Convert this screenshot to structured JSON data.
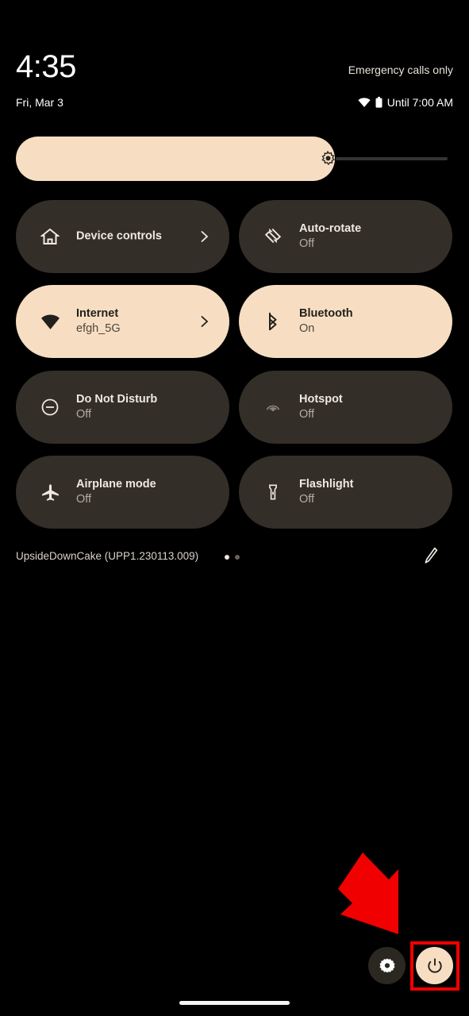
{
  "statusbar": {
    "time": "4:35",
    "date": "Fri, Mar 3",
    "carrier": "Emergency calls only",
    "alarm_text": "Until 7:00 AM",
    "wifi_icon": "wifi-icon",
    "battery_icon": "battery-icon"
  },
  "brightness": {
    "icon": "brightness-icon",
    "level_percent": 73,
    "fill_color": "#f7dec2",
    "track_color": "#343434"
  },
  "tiles": [
    {
      "label": "Device controls",
      "state": "",
      "icon": "home-icon",
      "active": false,
      "chevron": true,
      "dim_icon": false
    },
    {
      "label": "Auto-rotate",
      "state": "Off",
      "icon": "auto-rotate-icon",
      "active": false,
      "chevron": false,
      "dim_icon": false
    },
    {
      "label": "Internet",
      "state": "efgh_5G",
      "icon": "wifi-icon",
      "active": true,
      "chevron": true,
      "dim_icon": false
    },
    {
      "label": "Bluetooth",
      "state": "On",
      "icon": "bluetooth-icon",
      "active": true,
      "chevron": false,
      "dim_icon": false
    },
    {
      "label": "Do Not Disturb",
      "state": "Off",
      "icon": "do-not-disturb-icon",
      "active": false,
      "chevron": false,
      "dim_icon": false
    },
    {
      "label": "Hotspot",
      "state": "Off",
      "icon": "hotspot-icon",
      "active": false,
      "chevron": false,
      "dim_icon": true
    },
    {
      "label": "Airplane mode",
      "state": "Off",
      "icon": "airplane-icon",
      "active": false,
      "chevron": false,
      "dim_icon": false
    },
    {
      "label": "Flashlight",
      "state": "Off",
      "icon": "flashlight-icon",
      "active": false,
      "chevron": false,
      "dim_icon": false
    }
  ],
  "footer": {
    "build": "UpsideDownCake (UPP1.230113.009)",
    "page_dots": {
      "count": 2,
      "active_index": 0
    },
    "edit_icon": "pencil-icon"
  },
  "bottom_bar": {
    "settings_icon": "gear-icon",
    "power_icon": "power-icon"
  },
  "annotation": {
    "arrow_icon": "arrow-down-right-icon",
    "arrow_color": "#f00000",
    "highlight_color": "#f00000",
    "highlight_target": "power-button"
  },
  "navigation": {
    "home_bar": "home-gesture-bar"
  },
  "theme": {
    "background": "#000000",
    "tile_inactive": "#332e28",
    "tile_active": "#f7dec2",
    "text_primary": "#efe9e1",
    "text_secondary": "#b4aca1"
  }
}
